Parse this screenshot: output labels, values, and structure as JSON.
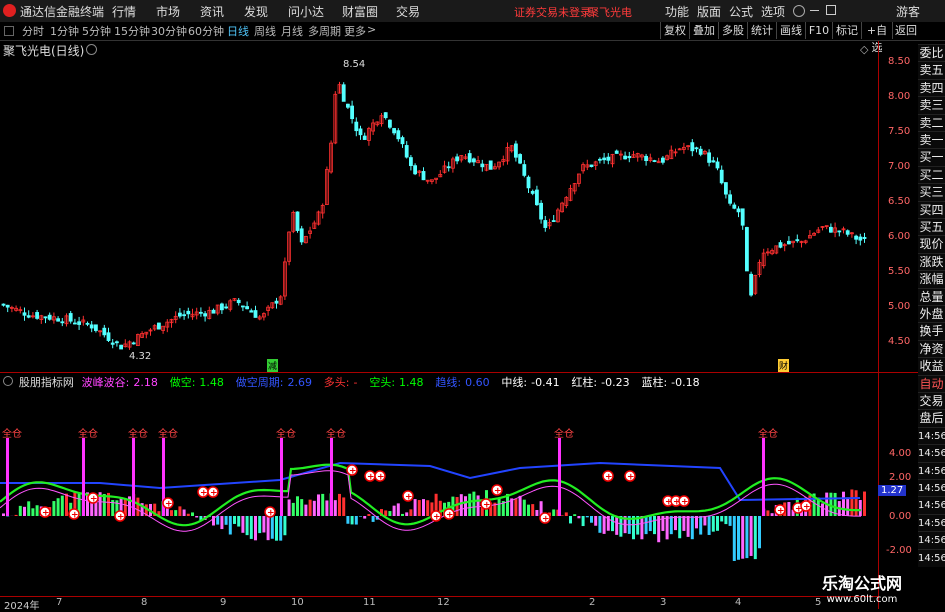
{
  "app": {
    "logo_text": "通达信金融终端",
    "menu": [
      "行情",
      "市场",
      "资讯",
      "发现",
      "问小达",
      "财富圈",
      "交易"
    ],
    "notice": "证券交易未登录",
    "stock_link": "聚飞光电",
    "right_menu": [
      "功能",
      "版面",
      "公式",
      "选项"
    ],
    "user": "游客"
  },
  "tabs": {
    "periods": [
      "分时",
      "1分钟",
      "5分钟",
      "15分钟",
      "30分钟",
      "60分钟",
      "日线",
      "周线",
      "月线",
      "多周期",
      "更多"
    ],
    "active": "日线",
    "more_arrow": ">",
    "right_buttons": [
      "复权",
      "叠加",
      "多股",
      "统计",
      "画线",
      "F10",
      "标记",
      "+自选",
      "返回"
    ]
  },
  "main_chart": {
    "title": "聚飞光电(日线)",
    "high_label": "8.54",
    "low_label": "4.32",
    "y_ticks": [
      "8.50",
      "8.00",
      "7.50",
      "7.00",
      "6.50",
      "6.00",
      "5.50",
      "5.00",
      "4.50"
    ],
    "marker_1": "减",
    "marker_2": "财"
  },
  "side_panel": {
    "labels": [
      "委比",
      "卖五",
      "卖四",
      "卖三",
      "卖二",
      "卖一",
      "买一",
      "买二",
      "买三",
      "买四",
      "买五",
      "现价",
      "涨跌",
      "涨幅",
      "总量",
      "外盘",
      "换手",
      "净资",
      "收益",
      "自动",
      "交易",
      "盘后",
      "14:56",
      "14:56",
      "14:56",
      "14:56",
      "14:56",
      "14:56",
      "14:56",
      "14:56"
    ]
  },
  "indicator": {
    "name": "股朋指标网",
    "legend": [
      {
        "label": "波峰波谷:",
        "value": "2.18",
        "color": "#ff44ff"
      },
      {
        "label": "做空:",
        "value": "1.48",
        "color": "#00ff00"
      },
      {
        "label": "做空周期:",
        "value": "2.69",
        "color": "#3355ff"
      },
      {
        "label": "多头:",
        "value": "-",
        "color": "#ff3333"
      },
      {
        "label": "空头:",
        "value": "1.48",
        "color": "#00ff00"
      },
      {
        "label": "趋线:",
        "value": "0.60",
        "color": "#3355ff"
      },
      {
        "label": "中线:",
        "value": "-0.41",
        "color": "#ffffff"
      },
      {
        "label": "红柱:",
        "value": "-0.23",
        "color": "#ffffff"
      },
      {
        "label": "蓝柱:",
        "value": "-0.18",
        "color": "#ffffff"
      }
    ],
    "y_ticks": [
      "4.00",
      "2.00",
      "0.00",
      "-2.00"
    ],
    "current_value": "1.27",
    "full_position_label": "全仓"
  },
  "x_axis": {
    "labels": [
      "2024年",
      "7",
      "8",
      "9",
      "10",
      "11",
      "12",
      "2",
      "3",
      "4",
      "5"
    ]
  },
  "watermark": {
    "line1": "乐淘公式网",
    "line2": "www.60lt.com"
  },
  "colors": {
    "up": "#ff3030",
    "down": "#54ffff",
    "accent": "#4fc3f7"
  }
}
